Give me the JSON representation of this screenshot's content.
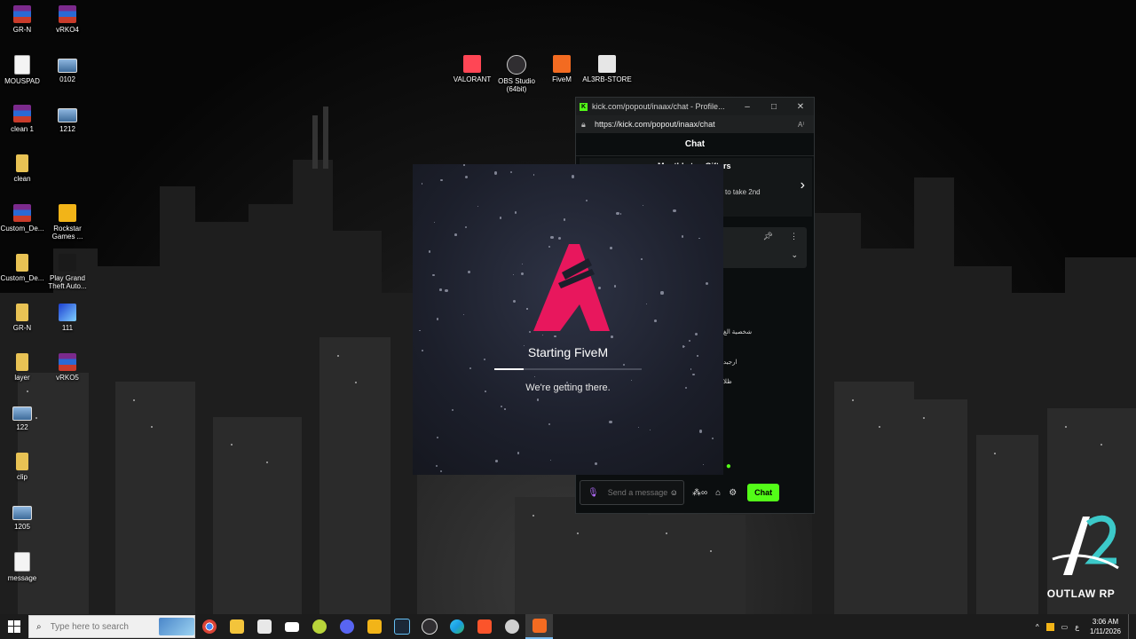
{
  "desktop": {
    "icons": [
      {
        "label": "GR-N",
        "type": "winrar"
      },
      {
        "label": "vRKO4",
        "type": "winrar"
      },
      {
        "label": "MOUSPAD",
        "type": "doc"
      },
      {
        "label": "0102",
        "type": "img"
      },
      {
        "label": "clean 1",
        "type": "winrar"
      },
      {
        "label": "1212",
        "type": "img"
      },
      {
        "label": "clean",
        "type": "folder"
      },
      {
        "label": "Custom_De...",
        "type": "winrar"
      },
      {
        "label": "Rockstar Games ...",
        "type": "rockstar"
      },
      {
        "label": "Custom_De...",
        "type": "folder"
      },
      {
        "label": "Play Grand Theft Auto...",
        "type": "gta"
      },
      {
        "label": "GR-N",
        "type": "folder"
      },
      {
        "label": "111",
        "type": "blueimg"
      },
      {
        "label": "layer",
        "type": "folder"
      },
      {
        "label": "vRKO5",
        "type": "winrar"
      },
      {
        "label": "122",
        "type": "img"
      },
      {
        "label": "clip",
        "type": "folder"
      },
      {
        "label": "1205",
        "type": "img"
      },
      {
        "label": "message",
        "type": "doc"
      },
      {
        "label": "VALORANT",
        "type": "valorant"
      },
      {
        "label": "OBS Studio (64bit)",
        "type": "obs"
      },
      {
        "label": "FiveM",
        "type": "fivem"
      },
      {
        "label": "AL3RB-STORE",
        "type": "al3rb"
      }
    ]
  },
  "browser_popup": {
    "title": "kick.com/popout/inaax/chat - Profile...",
    "url": "https://kick.com/popout/inaax/chat",
    "chat_header": "Chat",
    "gifters_title": "Monthly top Gifters",
    "gifters_subtitle": "to take 2nd",
    "messages": [
      "شخصية الغ",
      "ارجيد",
      "ظلا"
    ],
    "input_placeholder": "Send a message",
    "chat_button": "Chat"
  },
  "splash": {
    "title": "Starting FiveM",
    "subtitle": "We're getting there.",
    "progress": 0.2,
    "logo_color": "#e8175d"
  },
  "outlaw": {
    "brand": "OUTLAW RP"
  },
  "taskbar": {
    "search_placeholder": "Type here to search",
    "apps": [
      "chrome",
      "file-explorer",
      "store",
      "mail",
      "tennis-ball",
      "discord",
      "rockstar",
      "steam",
      "obs",
      "edge",
      "brave",
      "settings",
      "fivem"
    ],
    "language": "ع",
    "time": "3:06 AM",
    "date": "1/11/2026"
  },
  "colors": {
    "kick_green": "#53fc18",
    "fivem_pink": "#e8175d",
    "taskbar": "#1c1c1c"
  }
}
